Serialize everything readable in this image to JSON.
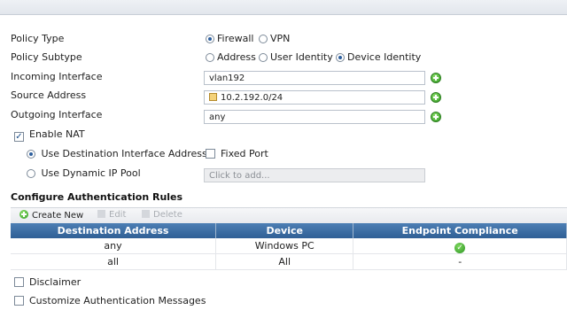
{
  "form": {
    "policy_type": {
      "label": "Policy Type",
      "options": [
        "Firewall",
        "VPN"
      ],
      "selected": "Firewall"
    },
    "policy_subtype": {
      "label": "Policy Subtype",
      "options": [
        "Address",
        "User Identity",
        "Device Identity"
      ],
      "selected": "Device Identity"
    },
    "incoming_interface": {
      "label": "Incoming Interface",
      "value": "vlan192"
    },
    "source_address": {
      "label": "Source Address",
      "value": "10.2.192.0/24"
    },
    "outgoing_interface": {
      "label": "Outgoing Interface",
      "value": "any"
    },
    "enable_nat": {
      "label": "Enable NAT",
      "checked": true
    },
    "use_dest_iface": {
      "label": "Use Destination Interface Address",
      "selected": true
    },
    "fixed_port": {
      "label": "Fixed Port",
      "checked": false
    },
    "dynamic_ip_pool": {
      "label": "Use Dynamic IP Pool",
      "selected": false,
      "placeholder": "Click to add..."
    }
  },
  "auth": {
    "title": "Configure Authentication Rules",
    "toolbar": {
      "create": "Create New",
      "edit": "Edit",
      "delete": "Delete"
    },
    "columns": [
      "Destination Address",
      "Device",
      "Endpoint Compliance"
    ],
    "rows": [
      {
        "destination": "any",
        "device": "Windows PC",
        "compliance": "check-icon"
      },
      {
        "destination": "all",
        "device": "All",
        "compliance": "-"
      }
    ]
  },
  "options": {
    "disclaimer": {
      "label": "Disclaimer",
      "checked": false
    },
    "customize_auth": {
      "label": "Customize Authentication Messages",
      "checked": false
    }
  },
  "colors": {
    "header": "#3a6ba3",
    "add": "#3aa52a"
  }
}
